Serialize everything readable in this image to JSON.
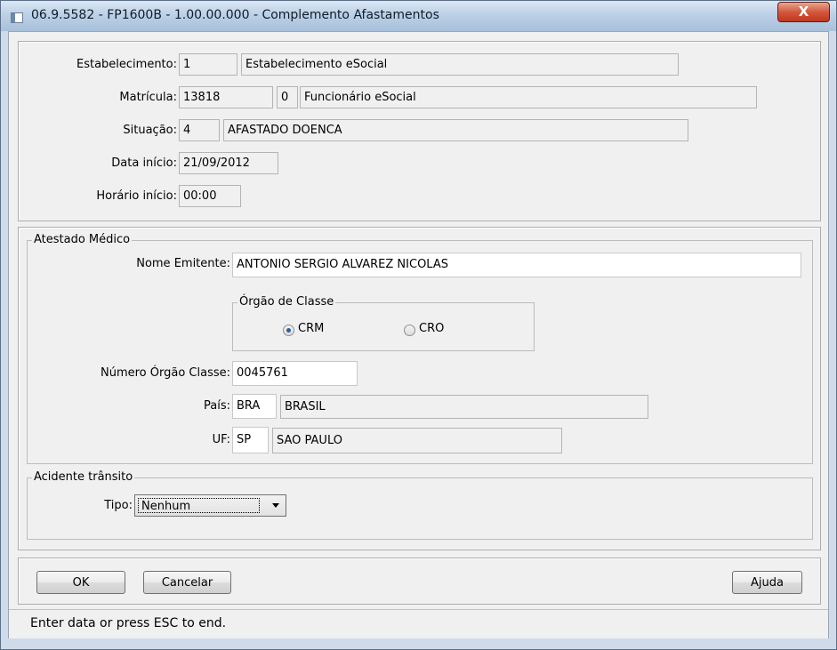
{
  "window": {
    "title": "06.9.5582 - FP1600B - 1.00.00.000 - Complemento Afastamentos",
    "close_glyph": "X"
  },
  "header": {
    "estabelecimento": {
      "label": "Estabelecimento:",
      "code": "1",
      "name": "Estabelecimento eSocial"
    },
    "matricula": {
      "label": "Matrícula:",
      "number": "13818",
      "digit": "0",
      "name": "Funcionário eSocial"
    },
    "situacao": {
      "label": "Situação:",
      "code": "4",
      "desc": "AFASTADO DOENCA"
    },
    "data_inicio": {
      "label": "Data início:",
      "value": "21/09/2012"
    },
    "horario_inicio": {
      "label": "Horário início:",
      "value": "00:00"
    }
  },
  "atestado": {
    "group_label": "Atestado Médico",
    "nome_emitente": {
      "label": "Nome Emitente:",
      "value": "ANTONIO SERGIO ALVAREZ NICOLAS"
    },
    "orgao_classe": {
      "group_label": "Órgão de Classe",
      "options": [
        "CRM",
        "CRO"
      ],
      "selected": "CRM"
    },
    "numero_orgao": {
      "label": "Número Órgão Classe:",
      "value": "0045761"
    },
    "pais": {
      "label": "País:",
      "code": "BRA",
      "name": "BRASIL"
    },
    "uf": {
      "label": "UF:",
      "code": "SP",
      "name": "SAO PAULO"
    }
  },
  "acidente": {
    "group_label": "Acidente trânsito",
    "tipo": {
      "label": "Tipo:",
      "selected": "Nenhum"
    }
  },
  "buttons": {
    "ok": "OK",
    "cancel": "Cancelar",
    "help": "Ajuda"
  },
  "status": {
    "text": "Enter data or press ESC to end."
  },
  "icons": {
    "close": "close-icon",
    "window": "window-icon",
    "dropdown": "chevron-down-icon",
    "radio": "radio-icon"
  }
}
